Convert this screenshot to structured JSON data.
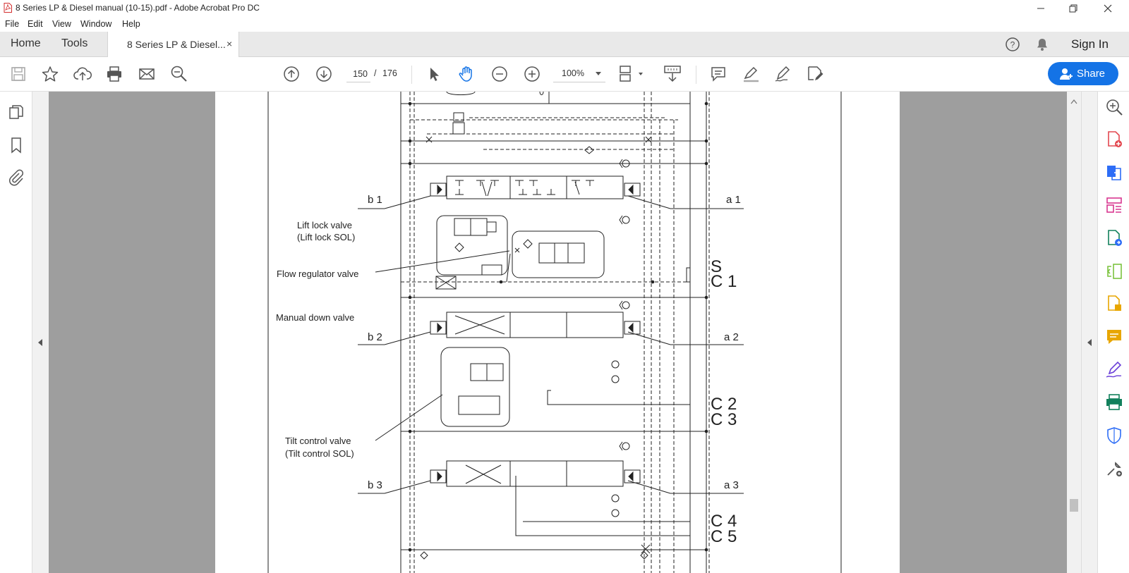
{
  "window": {
    "title": "8 Series LP & Diesel manual (10-15).pdf - Adobe Acrobat Pro DC"
  },
  "menu": [
    "File",
    "Edit",
    "View",
    "Window",
    "Help"
  ],
  "tabs": {
    "home": "Home",
    "tools": "Tools",
    "document": "8 Series LP & Diesel...",
    "close": "×"
  },
  "header": {
    "sign_in": "Sign In"
  },
  "toolbar": {
    "page_current": "150",
    "page_separator": "/",
    "page_total": "176",
    "zoom": "100%",
    "share": "Share"
  },
  "diagram": {
    "labels": {
      "lift_lock_1": "Lift lock valve",
      "lift_lock_2": "(Lift lock SOL)",
      "flow_regulator": "Flow regulator valve",
      "manual_down": "Manual down valve",
      "tilt_control_1": "Tilt control valve",
      "tilt_control_2": "(Tilt control SOL)"
    },
    "ports": {
      "b1": "b 1",
      "a1": "a 1",
      "b2": "b 2",
      "a2": "a 2",
      "b3": "b 3",
      "a3": "a 3",
      "s": "S",
      "c1": "C 1",
      "c2": "C 2",
      "c3": "C 3",
      "c4": "C 4",
      "c5": "C 5"
    }
  },
  "colors": {
    "accent": "#1473e6",
    "tool_red": "#e34850",
    "tool_blue": "#2d6df6",
    "tool_pink": "#d83790",
    "tool_teal": "#12805c",
    "tool_green": "#7cc33f",
    "tool_yellow": "#e8a600",
    "tool_purple": "#6a3fd8"
  }
}
